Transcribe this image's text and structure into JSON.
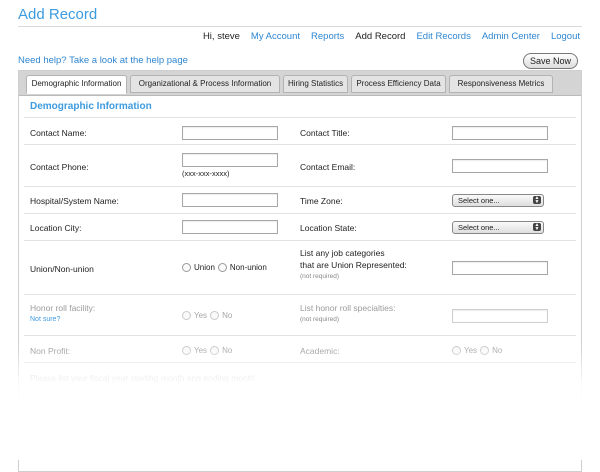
{
  "page": {
    "title": "Add Record"
  },
  "nav": {
    "greeting": "Hi, steve",
    "my_account": "My Account",
    "reports": "Reports",
    "add_record": "Add Record",
    "edit_records": "Edit Records",
    "admin_center": "Admin Center",
    "logout": "Logout"
  },
  "help": {
    "link": "Need help? Take a look at the help page"
  },
  "toolbar": {
    "save_now": "Save Now"
  },
  "tabs": [
    {
      "label": "Demographic Information",
      "active": true
    },
    {
      "label": "Organizational & Process Information",
      "active": false
    },
    {
      "label": "Hiring Statistics",
      "active": false
    },
    {
      "label": "Process Efficiency Data",
      "active": false
    },
    {
      "label": "Responsiveness Metrics",
      "active": false
    }
  ],
  "section": {
    "title": "Demographic Information"
  },
  "form": {
    "contact_name": {
      "label": "Contact Name:",
      "value": ""
    },
    "contact_title": {
      "label": "Contact Title:",
      "value": ""
    },
    "contact_phone": {
      "label": "Contact Phone:",
      "value": "",
      "hint": "(xxx-xxx-xxxx)"
    },
    "contact_email": {
      "label": "Contact Email:",
      "value": ""
    },
    "hospital_name": {
      "label": "Hospital/System Name:",
      "value": ""
    },
    "time_zone": {
      "label": "Time Zone:",
      "selected": "Select one..."
    },
    "location_city": {
      "label": "Location City:",
      "value": ""
    },
    "location_state": {
      "label": "Location State:",
      "selected": "Select one..."
    },
    "union": {
      "label": "Union/Non-union",
      "opt_union": "Union",
      "opt_nonunion": "Non-union"
    },
    "job_categories": {
      "label_line1": "List any job categories",
      "label_line2": "that are Union Represented:",
      "note": "(not required)",
      "value": ""
    },
    "honor_roll": {
      "label": "Honor roll facility:",
      "link": "Not sure?",
      "opt_yes": "Yes",
      "opt_no": "No"
    },
    "honor_specialties": {
      "label": "List honor roll specialties:",
      "note": "(not required)",
      "value": ""
    },
    "non_profit": {
      "label": "Non Profit:",
      "opt_yes": "Yes",
      "opt_no": "No"
    },
    "academic": {
      "label": "Academic:",
      "opt_yes": "Yes",
      "opt_no": "No"
    },
    "fiscal_year": {
      "label": "Please list your fiscal year starting month and ending month"
    }
  }
}
